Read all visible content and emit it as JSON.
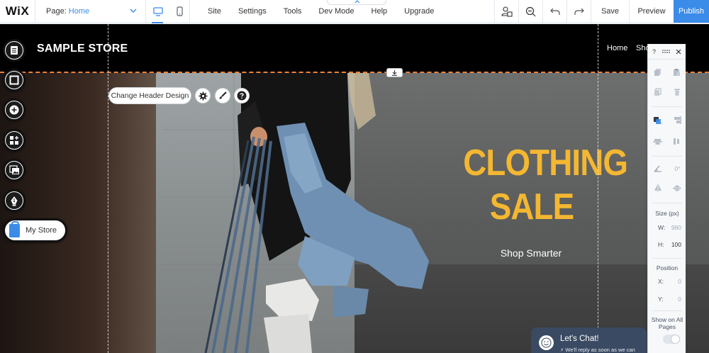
{
  "topbar": {
    "logo": "WiX",
    "page_label": "Page:",
    "page_value": "Home",
    "menu": [
      "Site",
      "Settings",
      "Tools",
      "Dev Mode",
      "Help",
      "Upgrade"
    ],
    "save_label": "Save",
    "preview_label": "Preview",
    "publish_label": "Publish"
  },
  "site": {
    "store_name": "SAMPLE STORE",
    "nav": [
      "Home",
      "Sho"
    ],
    "hero_title_line1": "CLOTHING",
    "hero_title_line2": "SALE",
    "hero_subtitle": "Shop Smarter"
  },
  "editor": {
    "change_header_label": "Change Header Design",
    "my_store_label": "My Store"
  },
  "inspector": {
    "help": "?",
    "rotation_value": "0°",
    "size_label": "Size (px)",
    "w_label": "W:",
    "w_value": "980",
    "h_label": "H:",
    "h_value": "100",
    "position_label": "Position",
    "x_label": "X:",
    "x_value": "0",
    "y_label": "Y:",
    "y_value": "0",
    "show_on_all_label": "Show on All Pages"
  },
  "chat": {
    "title": "Let's Chat!",
    "subtitle": "We'll reply as soon as we can"
  },
  "colors": {
    "accent": "#3b8be8",
    "hero_title": "#f4b731",
    "header_bg": "#000000",
    "guide_orange": "#e8833a",
    "chat_bg": "#3b4a63"
  }
}
